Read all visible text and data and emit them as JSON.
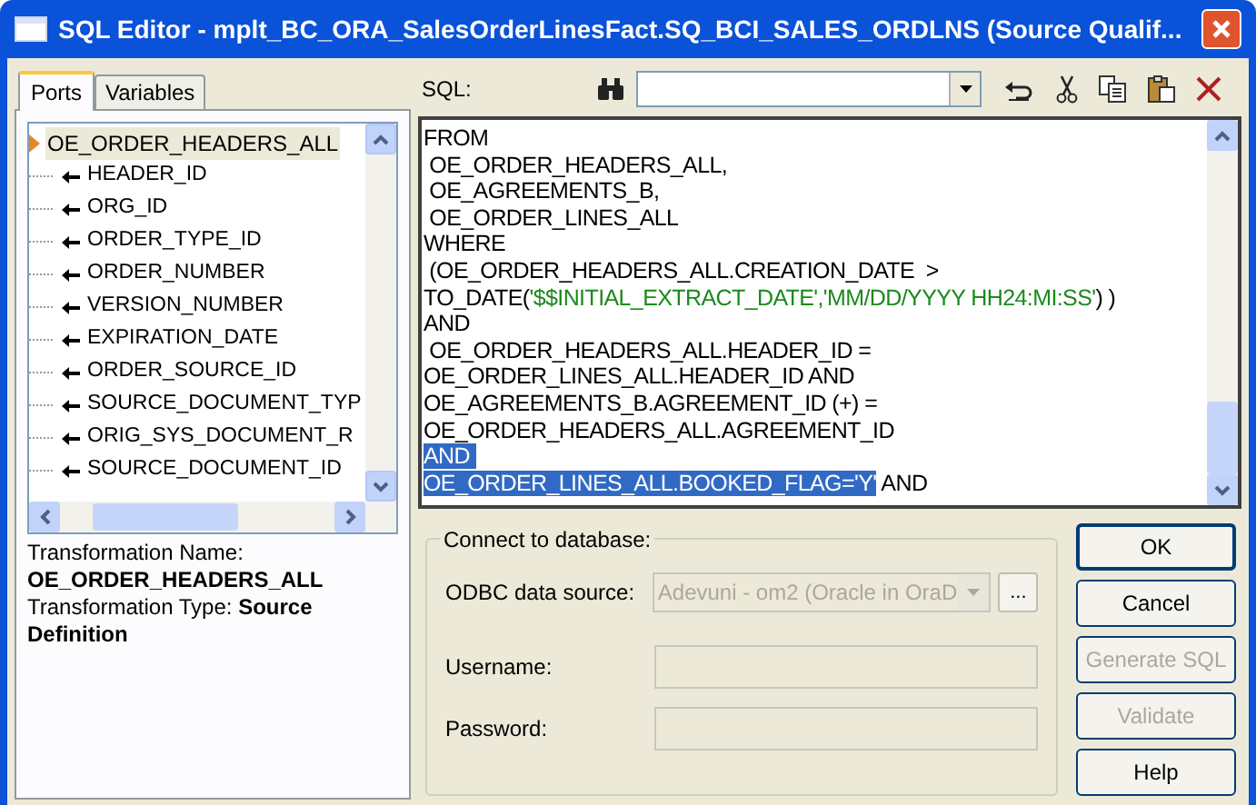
{
  "window": {
    "title": "SQL Editor - mplt_BC_ORA_SalesOrderLinesFact.SQ_BCI_SALES_ORDLNS (Source Qualif..."
  },
  "tabs": [
    {
      "label": "Ports",
      "selected": true
    },
    {
      "label": "Variables",
      "selected": false
    }
  ],
  "tree": {
    "label": "OE_ORDER_HEADERS_ALL",
    "selected": true,
    "children": [
      {
        "label": "HEADER_ID"
      },
      {
        "label": "ORG_ID"
      },
      {
        "label": "ORDER_TYPE_ID"
      },
      {
        "label": "ORDER_NUMBER"
      },
      {
        "label": "VERSION_NUMBER"
      },
      {
        "label": "EXPIRATION_DATE"
      },
      {
        "label": "ORDER_SOURCE_ID"
      },
      {
        "label": "SOURCE_DOCUMENT_TYP"
      },
      {
        "label": "ORIG_SYS_DOCUMENT_R"
      },
      {
        "label": "SOURCE_DOCUMENT_ID"
      }
    ]
  },
  "info": {
    "name_label": "Transformation Name:",
    "name_value": "OE_ORDER_HEADERS_ALL",
    "type_text": "Transformation Type:  **Source Definition**"
  },
  "sql_toolbar": {
    "label": "SQL:"
  },
  "sql_lines": [
    [
      {
        "text": "FROM",
        "kind": "plain",
        "selected": false
      }
    ],
    [
      {
        "text": " OE_ORDER_HEADERS_ALL,",
        "kind": "plain",
        "selected": false
      }
    ],
    [
      {
        "text": " OE_AGREEMENTS_B,",
        "kind": "plain",
        "selected": false
      }
    ],
    [
      {
        "text": " OE_ORDER_LINES_ALL",
        "kind": "plain",
        "selected": false
      }
    ],
    [
      {
        "text": "WHERE",
        "kind": "plain",
        "selected": false
      }
    ],
    [
      {
        "text": " (OE_ORDER_HEADERS_ALL.CREATION_DATE  >",
        "kind": "plain",
        "selected": false
      }
    ],
    [
      {
        "text": "TO_DATE(",
        "kind": "plain",
        "selected": false
      },
      {
        "text": "'$$INITIAL_EXTRACT_DATE','MM/DD/YYYY HH24:MI:SS'",
        "kind": "string",
        "selected": false
      },
      {
        "text": ") )",
        "kind": "plain",
        "selected": false
      }
    ],
    [
      {
        "text": "AND",
        "kind": "plain",
        "selected": false
      }
    ],
    [
      {
        "text": " OE_ORDER_HEADERS_ALL.HEADER_ID =",
        "kind": "plain",
        "selected": false
      }
    ],
    [
      {
        "text": "OE_ORDER_LINES_ALL.HEADER_ID AND",
        "kind": "plain",
        "selected": false
      }
    ],
    [
      {
        "text": "OE_AGREEMENTS_B.AGREEMENT_ID (+) =",
        "kind": "plain",
        "selected": false
      }
    ],
    [
      {
        "text": "OE_ORDER_HEADERS_ALL.AGREEMENT_ID",
        "kind": "plain",
        "selected": false
      }
    ],
    [
      {
        "text": "AND ",
        "kind": "plain",
        "selected": true
      }
    ],
    [
      {
        "text": "OE_ORDER_LINES_ALL.BOOKED_FLAG='Y'",
        "kind": "plain",
        "selected": true
      },
      {
        "text": " AND",
        "kind": "plain",
        "selected": false
      }
    ]
  ],
  "connect": {
    "title": "Connect to database:",
    "odbc_label": "ODBC data source:",
    "odbc_value": "Adevuni - om2 (Oracle in OraD",
    "browse": "...",
    "username_label": "Username:",
    "password_label": "Password:",
    "disabled": true
  },
  "buttons": [
    {
      "label": "OK",
      "disabled": false,
      "default": true
    },
    {
      "label": "Cancel",
      "disabled": false,
      "default": false
    },
    {
      "label": "Generate SQL",
      "disabled": true,
      "default": false
    },
    {
      "label": "Validate",
      "disabled": true,
      "default": false
    },
    {
      "label": "Help",
      "disabled": false,
      "default": false
    }
  ]
}
